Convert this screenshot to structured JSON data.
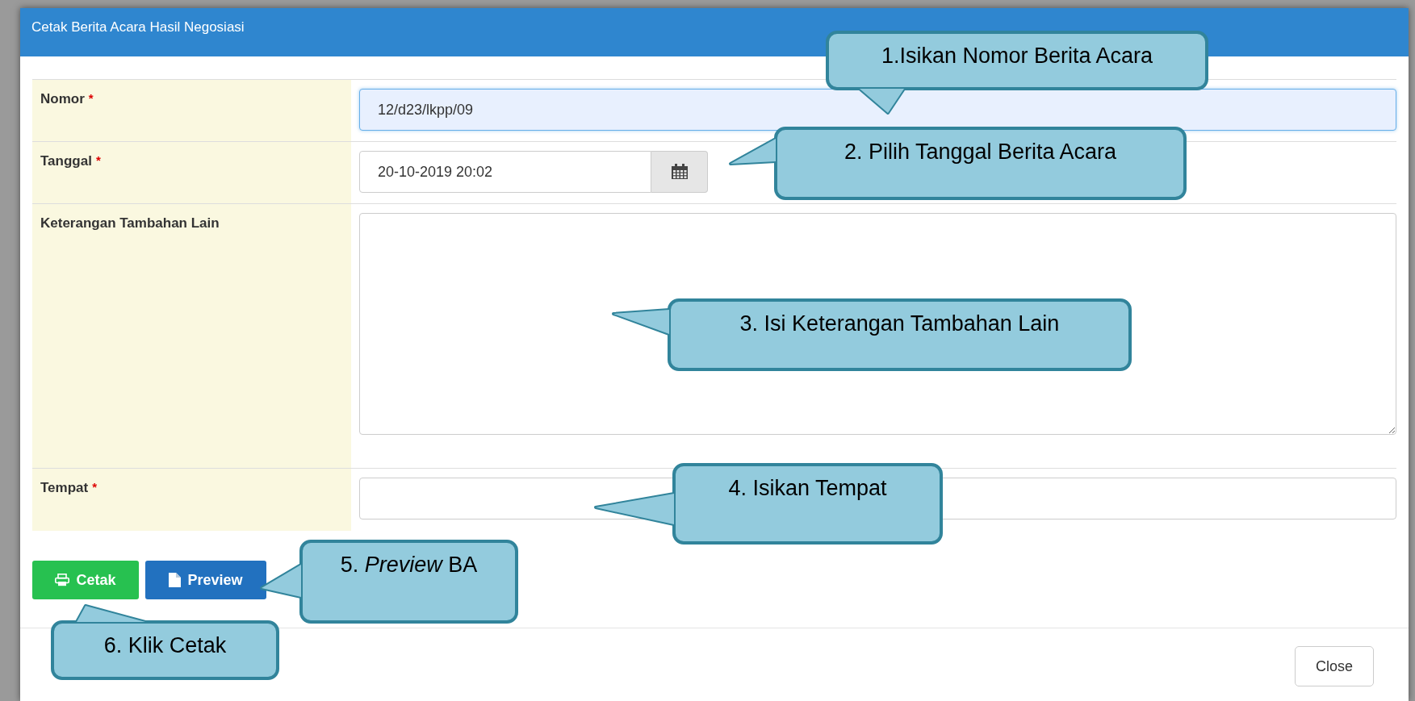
{
  "dialog": {
    "title": "Cetak Berita Acara Hasil Negosiasi"
  },
  "fields": [
    {
      "label": "Nomor",
      "required_mark": "*",
      "kind": "input",
      "value": "12/d23/lkpp/09",
      "focused": true
    },
    {
      "label": "Tanggal",
      "required_mark": "*",
      "kind": "date",
      "value": "20-10-2019 20:02",
      "focused": false
    },
    {
      "label": "Keterangan Tambahan Lain",
      "kind": "textarea",
      "focused": false
    },
    {
      "label": "Tempat",
      "required_mark": "*",
      "kind": "input",
      "focused": false
    }
  ],
  "actions": [
    {
      "label": "Cetak",
      "kind": "print"
    },
    {
      "label": "Preview",
      "kind": "preview"
    }
  ],
  "footer": {
    "close": "Close"
  },
  "callouts": [
    {
      "text": "1.Isikan Nomor Berita Acara"
    },
    {
      "text": "2. Pilih Tanggal Berita Acara"
    },
    {
      "text": "3. Isi Keterangan Tambahan Lain"
    },
    {
      "text": "4. Isikan Tempat"
    },
    {
      "text": "5. *Preview* BA"
    },
    {
      "text": "6. Klik Cetak"
    }
  ]
}
